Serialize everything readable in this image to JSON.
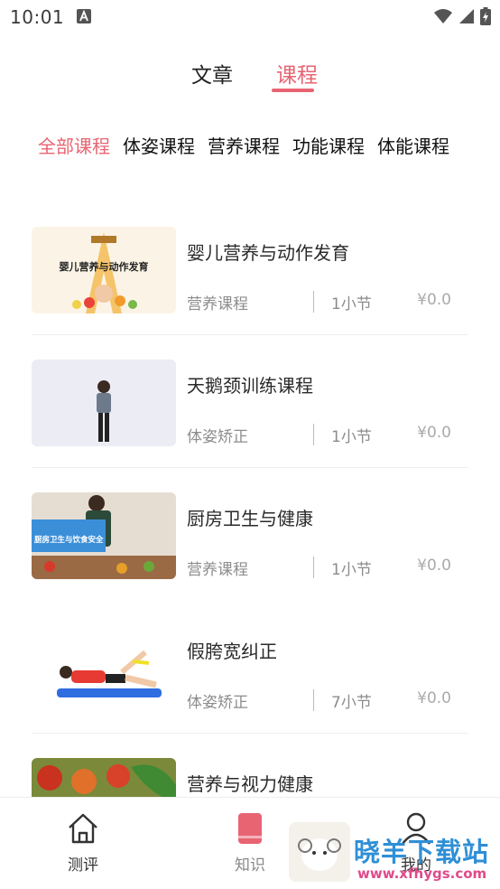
{
  "status_bar": {
    "time": "10:01"
  },
  "top_tabs": [
    {
      "label": "文章"
    },
    {
      "label": "课程"
    }
  ],
  "categories": [
    {
      "label": "全部课程"
    },
    {
      "label": "体姿课程"
    },
    {
      "label": "营养课程"
    },
    {
      "label": "功能课程"
    },
    {
      "label": "体能课程"
    }
  ],
  "courses": [
    {
      "title": "婴儿营养与动作发育",
      "tag": "营养课程",
      "sessions": "1小节",
      "price": "¥0.0",
      "thumb_caption": "婴儿营养与动作发育"
    },
    {
      "title": "天鹅颈训练课程",
      "tag": "体姿矫正",
      "sessions": "1小节",
      "price": "¥0.0"
    },
    {
      "title": "厨房卫生与健康",
      "tag": "营养课程",
      "sessions": "1小节",
      "price": "¥0.0",
      "thumb_caption": "厨房卫生与饮食安全"
    },
    {
      "title": "假胯宽纠正",
      "tag": "体姿矫正",
      "sessions": "7小节",
      "price": "¥0.0"
    },
    {
      "title": "营养与视力健康"
    }
  ],
  "bottom_nav": [
    {
      "label": "测评",
      "icon": "home-icon"
    },
    {
      "label": "知识",
      "icon": "book-icon"
    },
    {
      "label": "我的",
      "icon": "person-icon"
    }
  ],
  "watermark": {
    "text": "晓羊下载站",
    "url": "www.xfhygs.com"
  },
  "colors": {
    "accent": "#e86472",
    "text": "#2a2a2a",
    "muted": "#8c8c8c"
  }
}
